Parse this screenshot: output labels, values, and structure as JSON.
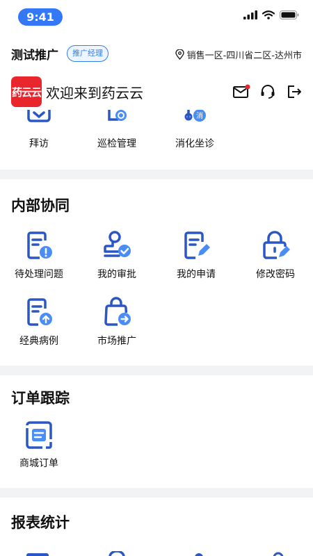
{
  "status": {
    "time": "9:41"
  },
  "user": {
    "name": "测试推广",
    "role": "推广经理",
    "location": "销售一区-四川省二区-达州市"
  },
  "app": {
    "logo_text": "药云云",
    "welcome": "欢迎来到药云云"
  },
  "top_items": [
    {
      "label": "拜访"
    },
    {
      "label": "巡检管理"
    },
    {
      "label": "消化坐诊"
    }
  ],
  "internal": {
    "title": "内部协同",
    "items": [
      {
        "label": "待处理问题"
      },
      {
        "label": "我的审批"
      },
      {
        "label": "我的申请"
      },
      {
        "label": "修改密码"
      },
      {
        "label": "经典病例"
      },
      {
        "label": "市场推广"
      }
    ]
  },
  "orders": {
    "title": "订单跟踪",
    "items": [
      {
        "label": "商城订单"
      }
    ]
  },
  "reports": {
    "title": "报表统计"
  },
  "colors": {
    "accent": "#2f7ff0",
    "icon_dark": "#2a56c6",
    "brand_red": "#e8262c",
    "separator": "#f2f3f5"
  }
}
